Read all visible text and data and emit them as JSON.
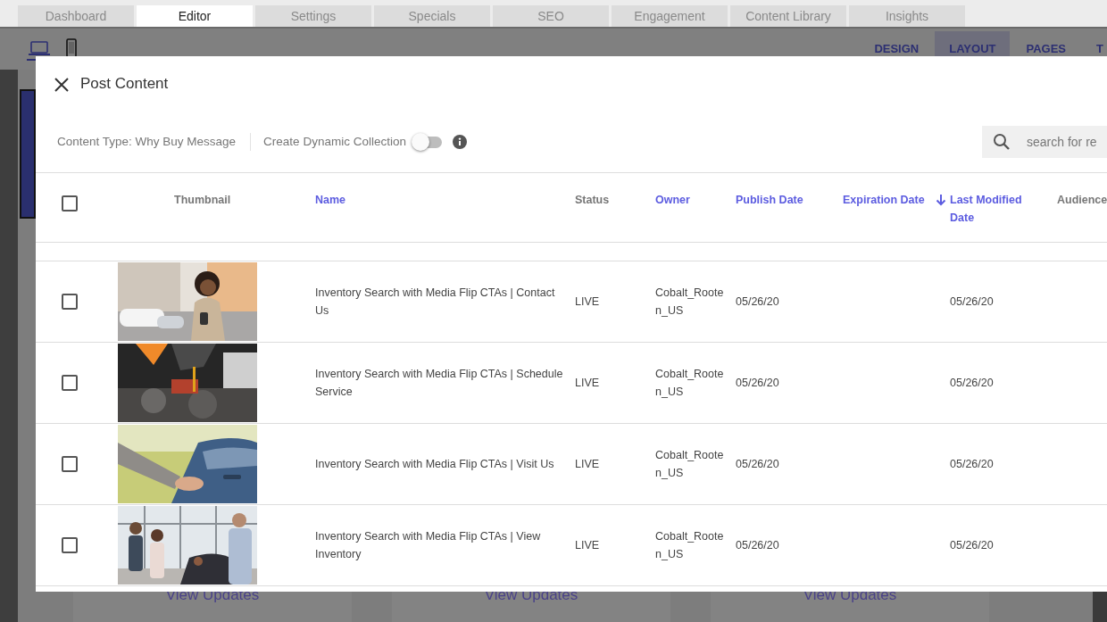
{
  "top_tabs": [
    {
      "label": "Dashboard",
      "selected": false
    },
    {
      "label": "Editor",
      "selected": true
    },
    {
      "label": "Settings",
      "selected": false
    },
    {
      "label": "Specials",
      "selected": false
    },
    {
      "label": "SEO",
      "selected": false
    },
    {
      "label": "Engagement",
      "selected": false
    },
    {
      "label": "Content Library",
      "selected": false
    },
    {
      "label": "Insights",
      "selected": false
    }
  ],
  "device_toggle": [
    {
      "kind": "desktop",
      "selected": true
    },
    {
      "kind": "mobile",
      "selected": false
    }
  ],
  "editor_tabs": [
    {
      "label": "DESIGN",
      "selected": false
    },
    {
      "label": "LAYOUT",
      "selected": true
    },
    {
      "label": "PAGES",
      "selected": false
    },
    {
      "label": "T",
      "selected": false
    }
  ],
  "background_cards": [
    {
      "link": "View Updates"
    },
    {
      "link": "View Updates"
    },
    {
      "link": "View Updates"
    }
  ],
  "dialog": {
    "title": "Post Content",
    "content_type": "Content Type: Why Buy Message",
    "dynamic_collection": {
      "label": "Create Dynamic Collection",
      "on": false
    },
    "search": {
      "placeholder": "search for re"
    },
    "select_all": {
      "checked": false
    },
    "columns": [
      {
        "label": "Thumbnail",
        "sortable": false,
        "sorted": false
      },
      {
        "label": "Name",
        "sortable": true,
        "sorted": false
      },
      {
        "label": "Status",
        "sortable": false,
        "sorted": false
      },
      {
        "label": "Owner",
        "sortable": true,
        "sorted": false
      },
      {
        "label": "Publish Date",
        "sortable": true,
        "sorted": false
      },
      {
        "label": "Expiration Date",
        "sortable": true,
        "sorted": false
      },
      {
        "label": "Last Modified Date",
        "sortable": true,
        "sorted": true
      },
      {
        "label": "Audience",
        "sortable": false,
        "sorted": false
      }
    ],
    "rows": [
      {
        "checked": false,
        "name": "Inventory Search with Media Flip CTAs | Contact Us",
        "status": "LIVE",
        "owner": "Cobalt_Rooten_US",
        "publish_date": "05/26/20",
        "last_modified": "05/26/20"
      },
      {
        "checked": false,
        "name": "Inventory Search with Media Flip CTAs | Schedule Service",
        "status": "LIVE",
        "owner": "Cobalt_Rooten_US",
        "publish_date": "05/26/20",
        "last_modified": "05/26/20"
      },
      {
        "checked": false,
        "name": "Inventory Search with Media Flip CTAs | Visit Us",
        "status": "LIVE",
        "owner": "Cobalt_Rooten_US",
        "publish_date": "05/26/20",
        "last_modified": "05/26/20"
      },
      {
        "checked": false,
        "name": "Inventory Search with Media Flip CTAs | View Inventory",
        "status": "LIVE",
        "owner": "Cobalt_Rooten_US",
        "publish_date": "05/26/20",
        "last_modified": "05/26/20"
      }
    ]
  }
}
